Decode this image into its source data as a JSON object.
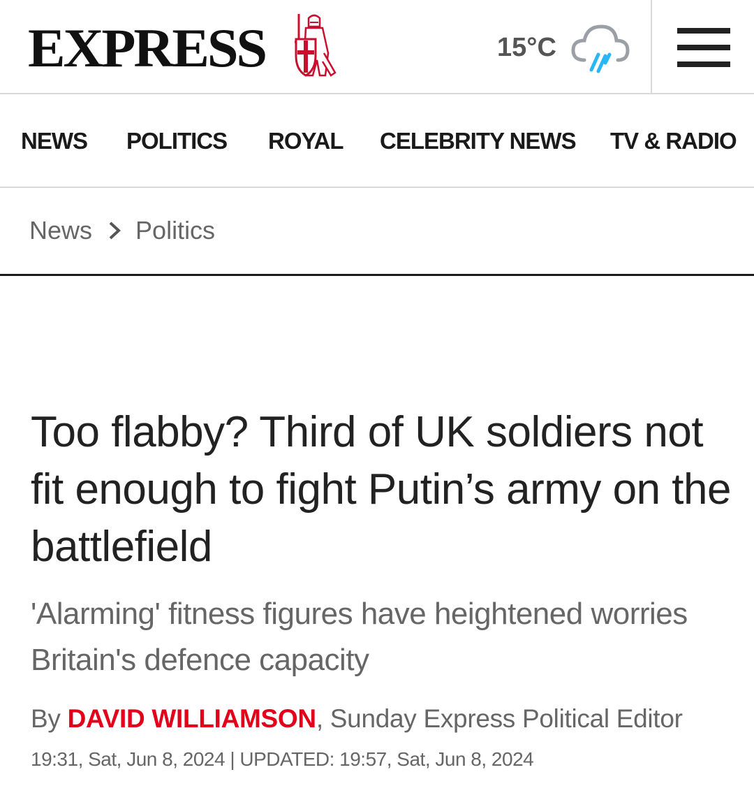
{
  "header": {
    "logo_text": "EXPRESS",
    "temperature": "15°C",
    "weather_icon": "cloud-rain-icon",
    "menu_icon": "hamburger-menu-icon"
  },
  "nav": {
    "items": [
      {
        "label": "NEWS"
      },
      {
        "label": "POLITICS"
      },
      {
        "label": "ROYAL"
      },
      {
        "label": "CELEBRITY NEWS"
      },
      {
        "label": "TV & RADIO"
      }
    ]
  },
  "breadcrumb": {
    "items": [
      "News",
      "Politics"
    ]
  },
  "article": {
    "headline": "Too flabby? Third of UK soldiers not fit enough to fight Putin’s army on the battlefield",
    "standfirst": "'Alarming' fitness figures have heightened worries Britain's defence capacity",
    "byline_prefix": "By ",
    "author": "DAVID WILLIAMSON",
    "author_role": ", Sunday Express Political Editor",
    "dateline": "19:31, Sat, Jun 8, 2024 | UPDATED: 19:57, Sat, Jun 8, 2024"
  },
  "colors": {
    "brand_red": "#e2001a",
    "text_dark": "#222222",
    "text_grey": "#666666",
    "weather_blue": "#29b6f6"
  }
}
